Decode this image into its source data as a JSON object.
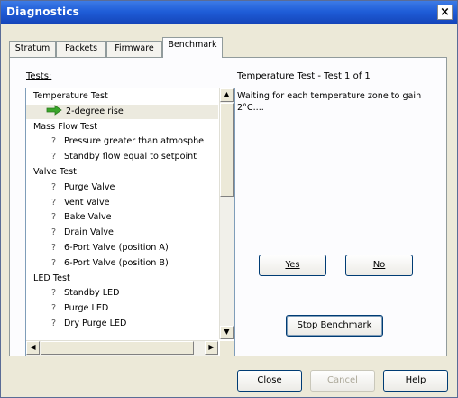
{
  "window": {
    "title": "Diagnostics",
    "close_glyph": "×"
  },
  "tabs": [
    {
      "label": "Stratum",
      "active": false
    },
    {
      "label": "Packets",
      "active": false
    },
    {
      "label": "Firmware",
      "active": false
    },
    {
      "label": "Benchmark",
      "active": true
    }
  ],
  "tests_panel": {
    "label": "Tests:",
    "rows": [
      {
        "type": "group",
        "text": "Temperature Test"
      },
      {
        "type": "item",
        "text": "2-degree rise",
        "selected": true,
        "icon": "green-arrow-icon"
      },
      {
        "type": "group",
        "text": "Mass Flow Test"
      },
      {
        "type": "item",
        "marker": "?",
        "text": "Pressure greater than atmosphe"
      },
      {
        "type": "item",
        "marker": "?",
        "text": "Standby flow equal to setpoint"
      },
      {
        "type": "group",
        "text": "Valve Test"
      },
      {
        "type": "item",
        "marker": "?",
        "text": "Purge Valve"
      },
      {
        "type": "item",
        "marker": "?",
        "text": "Vent Valve"
      },
      {
        "type": "item",
        "marker": "?",
        "text": "Bake Valve"
      },
      {
        "type": "item",
        "marker": "?",
        "text": "Drain Valve"
      },
      {
        "type": "item",
        "marker": "?",
        "text": "6-Port Valve (position A)"
      },
      {
        "type": "item",
        "marker": "?",
        "text": "6-Port Valve (position B)"
      },
      {
        "type": "group",
        "text": "LED Test"
      },
      {
        "type": "item",
        "marker": "?",
        "text": "Standby LED"
      },
      {
        "type": "item",
        "marker": "?",
        "text": "Purge LED"
      },
      {
        "type": "item",
        "marker": "?",
        "text": "Dry Purge LED"
      }
    ]
  },
  "test_header": "Temperature Test - Test 1 of 1",
  "status_message": "Waiting for each temperature zone to gain 2°C....",
  "buttons": {
    "yes": "Yes",
    "no": "No",
    "stop_benchmark": "Stop Benchmark",
    "close": "Close",
    "cancel": "Cancel",
    "help": "Help"
  },
  "colors": {
    "title_bar": "#1f5dd8",
    "arrow": "#3aa52a"
  }
}
